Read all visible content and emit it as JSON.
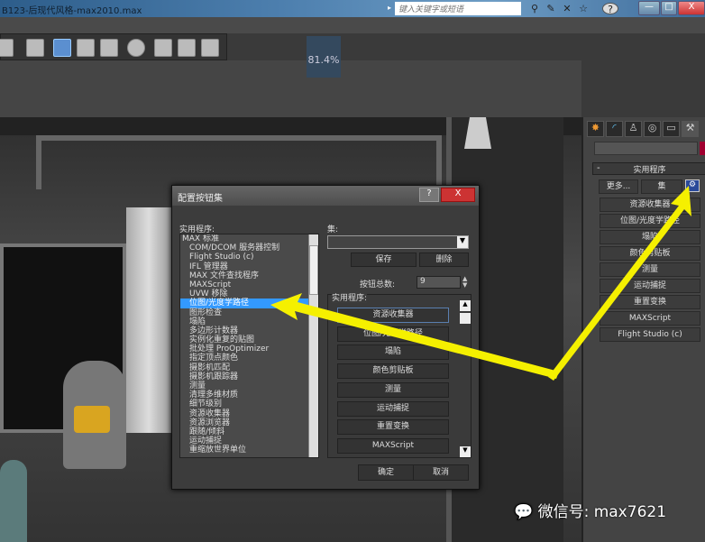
{
  "window": {
    "title": "B123-后现代风格-max2010.max",
    "search_placeholder": "键入关键字或短语",
    "help": "?",
    "minimize": "—",
    "maximize": "□",
    "close": "X"
  },
  "viewport": {
    "zoom_label": "81.4%"
  },
  "command_panel": {
    "tabs": [
      "create",
      "modify",
      "hierarchy",
      "motion",
      "display",
      "utilities"
    ],
    "rollout_title": "实用程序",
    "rollout_toggle": "-",
    "more_button": "更多...",
    "sets_button": "集",
    "buttons": [
      "资源收集器",
      "位图/光度学路径",
      "塌陷",
      "颜色剪贴板",
      "测量",
      "运动捕捉",
      "重置变换",
      "MAXScript",
      "Flight Studio (c)"
    ]
  },
  "dialog": {
    "title": "配置按钮集",
    "help": "?",
    "close": "X",
    "utilities_label": "实用程序:",
    "utilities": [
      {
        "label": "MAX 标准",
        "top": true
      },
      {
        "label": "COM/DCOM 服务器控制"
      },
      {
        "label": "Flight Studio (c)"
      },
      {
        "label": "IFL 管理器"
      },
      {
        "label": "MAX 文件查找程序"
      },
      {
        "label": "MAXScript"
      },
      {
        "label": "UVW 移除"
      },
      {
        "label": "位图/光度学路径",
        "selected": true
      },
      {
        "label": "图形检查"
      },
      {
        "label": "塌陷"
      },
      {
        "label": "多边形计数器"
      },
      {
        "label": "实例化重复的贴图"
      },
      {
        "label": "批处理 ProOptimizer"
      },
      {
        "label": "指定顶点颜色"
      },
      {
        "label": "摄影机匹配"
      },
      {
        "label": "摄影机跟踪器"
      },
      {
        "label": "测量"
      },
      {
        "label": "清理多维材质"
      },
      {
        "label": "细节级别"
      },
      {
        "label": "资源收集器"
      },
      {
        "label": "资源浏览器"
      },
      {
        "label": "跟随/倾斜"
      },
      {
        "label": "运动捕捉"
      },
      {
        "label": "重缩放世界单位"
      }
    ],
    "sets_label": "集:",
    "sets_value": "",
    "save": "保存",
    "delete": "删除",
    "total_label": "按钮总数:",
    "total_value": "9",
    "set_utilities_label": "实用程序:",
    "set_buttons": [
      "资源收集器",
      "位图/光度学路径",
      "塌陷",
      "颜色剪贴板",
      "测量",
      "运动捕捉",
      "重置变换",
      "MAXScript"
    ],
    "ok": "确定",
    "cancel": "取消"
  },
  "watermark": "微信号: max7621",
  "colors": {
    "arrow": "#f5f000",
    "selection": "#3399ff"
  }
}
